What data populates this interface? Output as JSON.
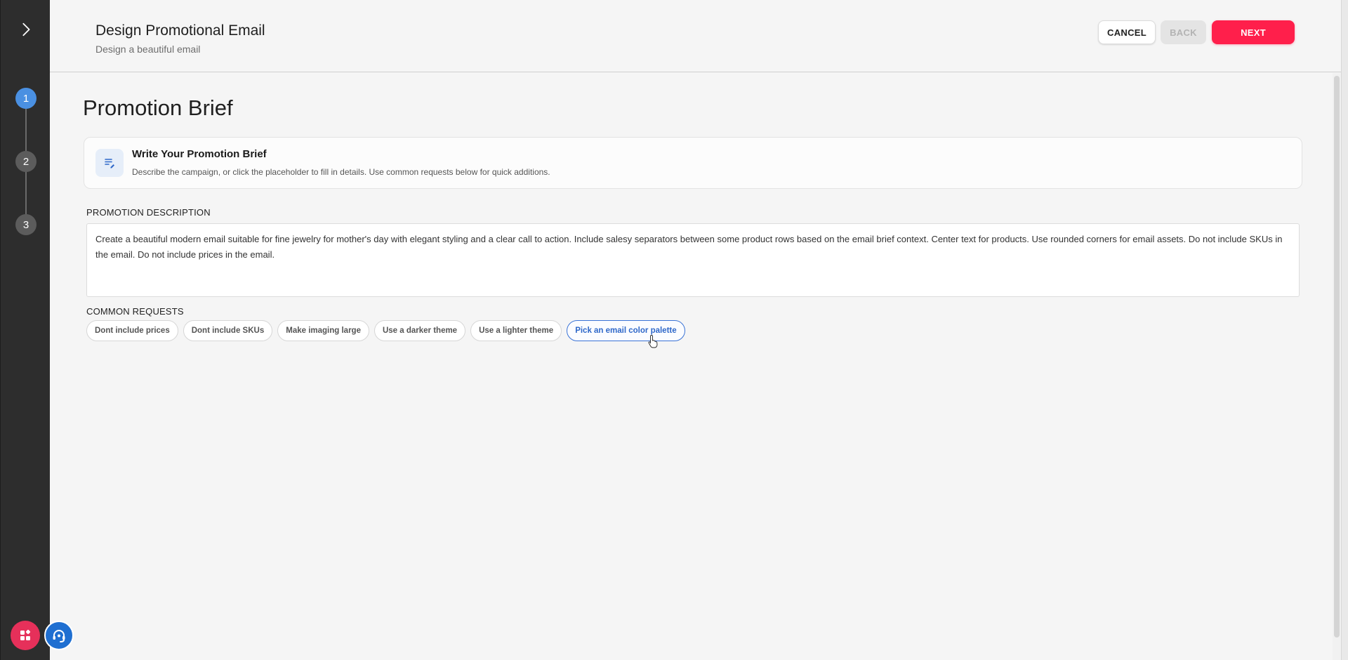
{
  "header": {
    "title": "Design Promotional Email",
    "subtitle": "Design a beautiful email",
    "cancel_label": "CANCEL",
    "back_label": "BACK",
    "next_label": "NEXT"
  },
  "rail": {
    "toggle_icon": "chevron-right-icon",
    "steps": [
      {
        "label": "1",
        "active": true
      },
      {
        "label": "2",
        "active": false
      },
      {
        "label": "3",
        "active": false
      }
    ],
    "bottom_icons": [
      "apps-icon",
      "support-icon"
    ]
  },
  "main": {
    "page_title": "Promotion Brief",
    "brief_card": {
      "icon": "edit-note-icon",
      "title": "Write Your Promotion Brief",
      "description": "Describe the campaign, or click the placeholder to fill in details. Use common requests below for quick additions."
    },
    "promotion_description": {
      "label": "PROMOTION DESCRIPTION",
      "value": "Create a beautiful modern email suitable for fine jewelry for mother's day with elegant styling and a clear call to action. Include salesy separators between some product rows based on the email brief context. Center text for products. Use rounded corners for email assets. Do not include SKUs in the email. Do not include prices in the email."
    },
    "common_requests": {
      "label": "COMMON REQUESTS",
      "chips": [
        "Dont include prices",
        "Dont include SKUs",
        "Make imaging large",
        "Use a darker theme",
        "Use a lighter theme",
        "Pick an email color palette"
      ],
      "hovered_chip": "Pick an email color palette"
    }
  },
  "colors": {
    "primary": "#ff1f4b",
    "active_step": "#4a90e2",
    "rail_bg": "#2d2d2d",
    "chip_hover": "#2f68c9"
  }
}
